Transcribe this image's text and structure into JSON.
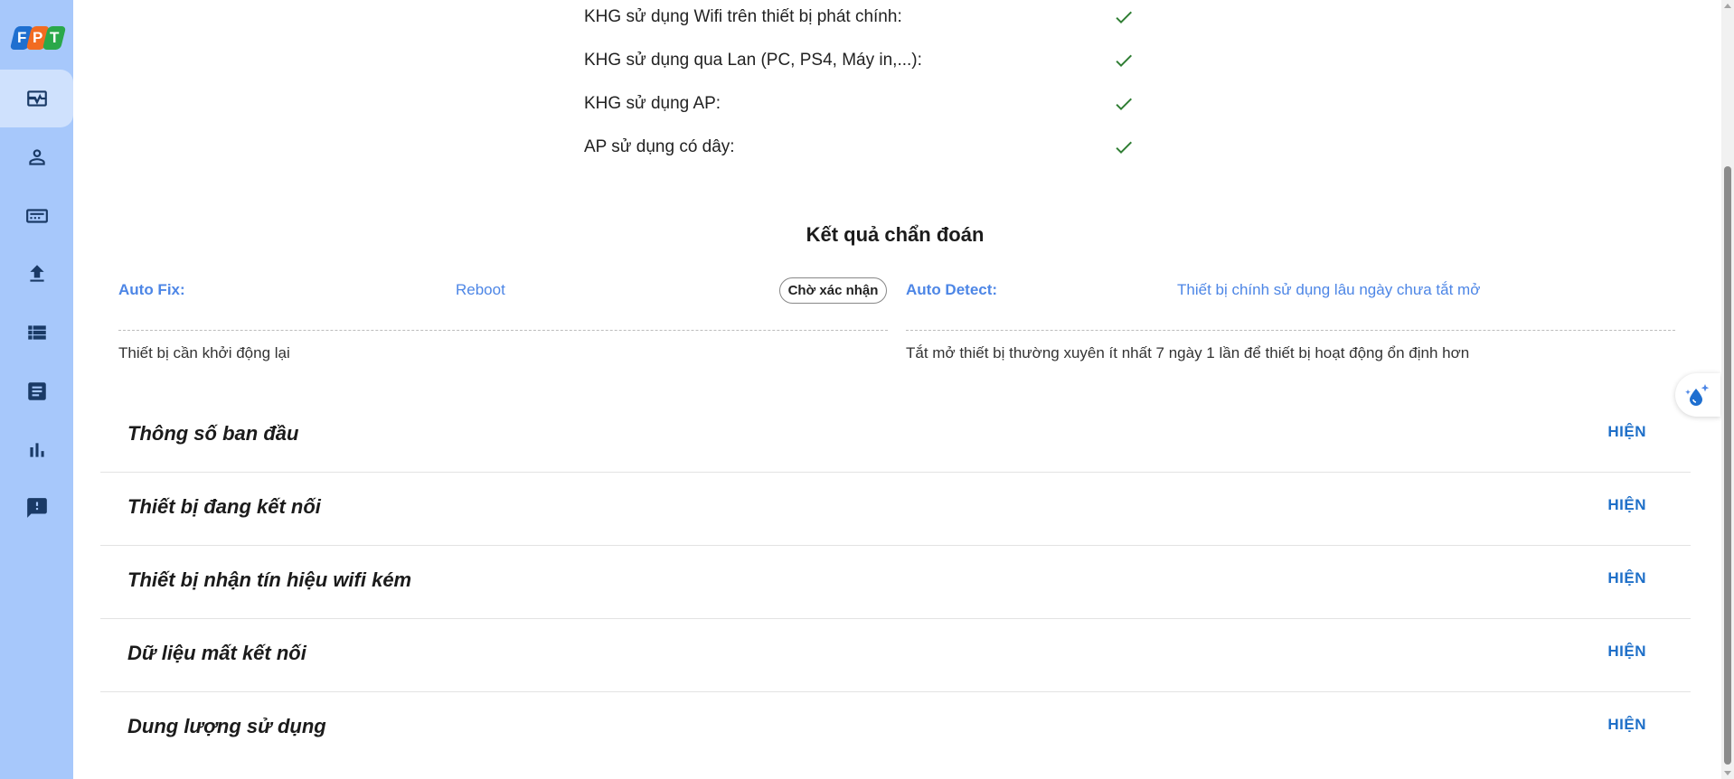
{
  "brand": {
    "logo_letters": [
      "F",
      "P",
      "T"
    ],
    "colors": [
      "#1e6fd0",
      "#f26b21",
      "#2aa84a"
    ]
  },
  "sidebar": {
    "items": [
      {
        "name": "monitor-heartbeat-icon",
        "active": true
      },
      {
        "name": "user-icon",
        "active": false
      },
      {
        "name": "device-box-icon",
        "active": false
      },
      {
        "name": "upload-icon",
        "active": false
      },
      {
        "name": "list-icon",
        "active": false
      },
      {
        "name": "document-icon",
        "active": false
      },
      {
        "name": "bar-chart-icon",
        "active": false
      },
      {
        "name": "feedback-icon",
        "active": false
      }
    ]
  },
  "checklist": [
    {
      "label": "KHG sử dụng Wifi trên thiết bị phát chính:",
      "checked": true
    },
    {
      "label": "KHG sử dụng qua Lan (PC, PS4, Máy in,...):",
      "checked": true
    },
    {
      "label": "KHG sử dụng AP:",
      "checked": true
    },
    {
      "label": "AP sử dụng có dây:",
      "checked": true
    }
  ],
  "diagnosis": {
    "title": "Kết quả chẩn đoán",
    "auto_fix": {
      "label": "Auto Fix:",
      "value": "Reboot",
      "status": "Chờ xác nhận",
      "description": "Thiết bị cần khởi động lại"
    },
    "auto_detect": {
      "label": "Auto Detect:",
      "value": "Thiết bị chính sử dụng lâu ngày chưa tắt mở",
      "description": "Tắt mở thiết bị thường xuyên ít nhất 7 ngày 1 lần để thiết bị hoạt động ổn định hơn"
    }
  },
  "sections": [
    {
      "title": "Thông số ban đầu",
      "action": "HIỆN"
    },
    {
      "title": "Thiết bị đang kết nối",
      "action": "HIỆN"
    },
    {
      "title": "Thiết bị nhận tín hiệu wifi kém",
      "action": "HIỆN"
    },
    {
      "title": "Dữ liệu mất kết nối",
      "action": "HIỆN"
    },
    {
      "title": "Dung lượng sử dụng",
      "action": "HIỆN"
    }
  ],
  "colors": {
    "sidebar": "#a7c8fb",
    "accent": "#4d86e6",
    "action": "#1e6fc8",
    "check": "#2e7d32"
  }
}
